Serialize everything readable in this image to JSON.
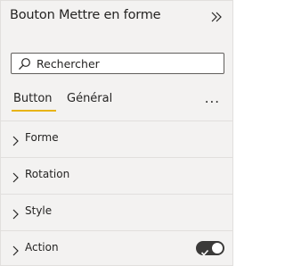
{
  "pane": {
    "title": "Bouton Mettre en forme"
  },
  "search": {
    "placeholder": "Rechercher",
    "value": ""
  },
  "tabs": [
    {
      "label": "Button",
      "active": true
    },
    {
      "label": "Général",
      "active": false
    }
  ],
  "more_label": "...",
  "sections": [
    {
      "label": "Forme"
    },
    {
      "label": "Rotation"
    },
    {
      "label": "Style"
    },
    {
      "label": "Action",
      "toggle": true,
      "toggle_on": true
    }
  ],
  "colors": {
    "accent": "#e8b417",
    "pane_bg": "#f3f2f1",
    "toggle_on": "#3b3a39"
  }
}
